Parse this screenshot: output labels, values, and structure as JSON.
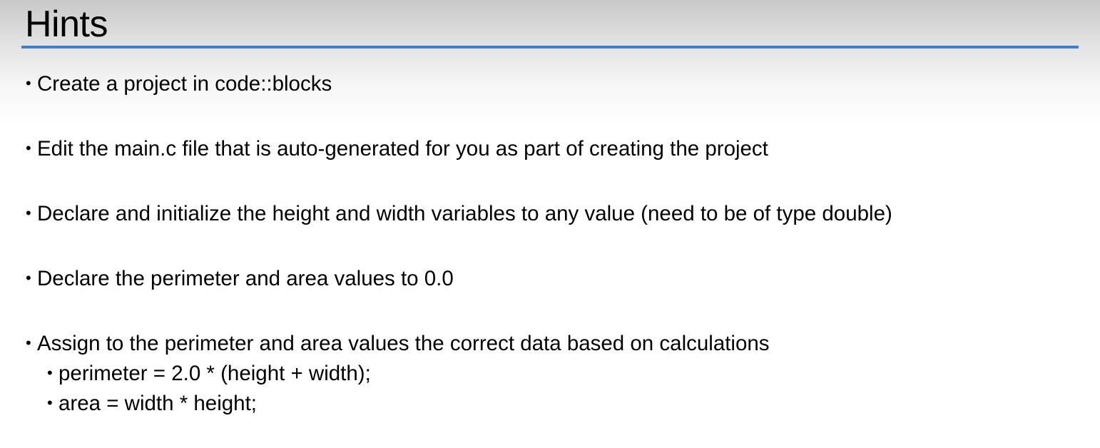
{
  "slide": {
    "title": "Hints",
    "bullets": [
      {
        "text": "Create a project in code::blocks"
      },
      {
        "text": "Edit the main.c file that is auto-generated for you as part of creating the project"
      },
      {
        "text": "Declare and initialize the height and width variables to any value (need to be of type double)"
      },
      {
        "text": "Declare the perimeter and area values to 0.0"
      },
      {
        "text": "Assign to the perimeter and area values the correct data based on calculations",
        "sub": [
          {
            "text": "perimeter = 2.0 * (height + width);"
          },
          {
            "text": "area = width * height;"
          }
        ]
      }
    ],
    "bullet_glyph": "•"
  },
  "colors": {
    "rule": "#3f7fd0",
    "text": "#000000"
  }
}
